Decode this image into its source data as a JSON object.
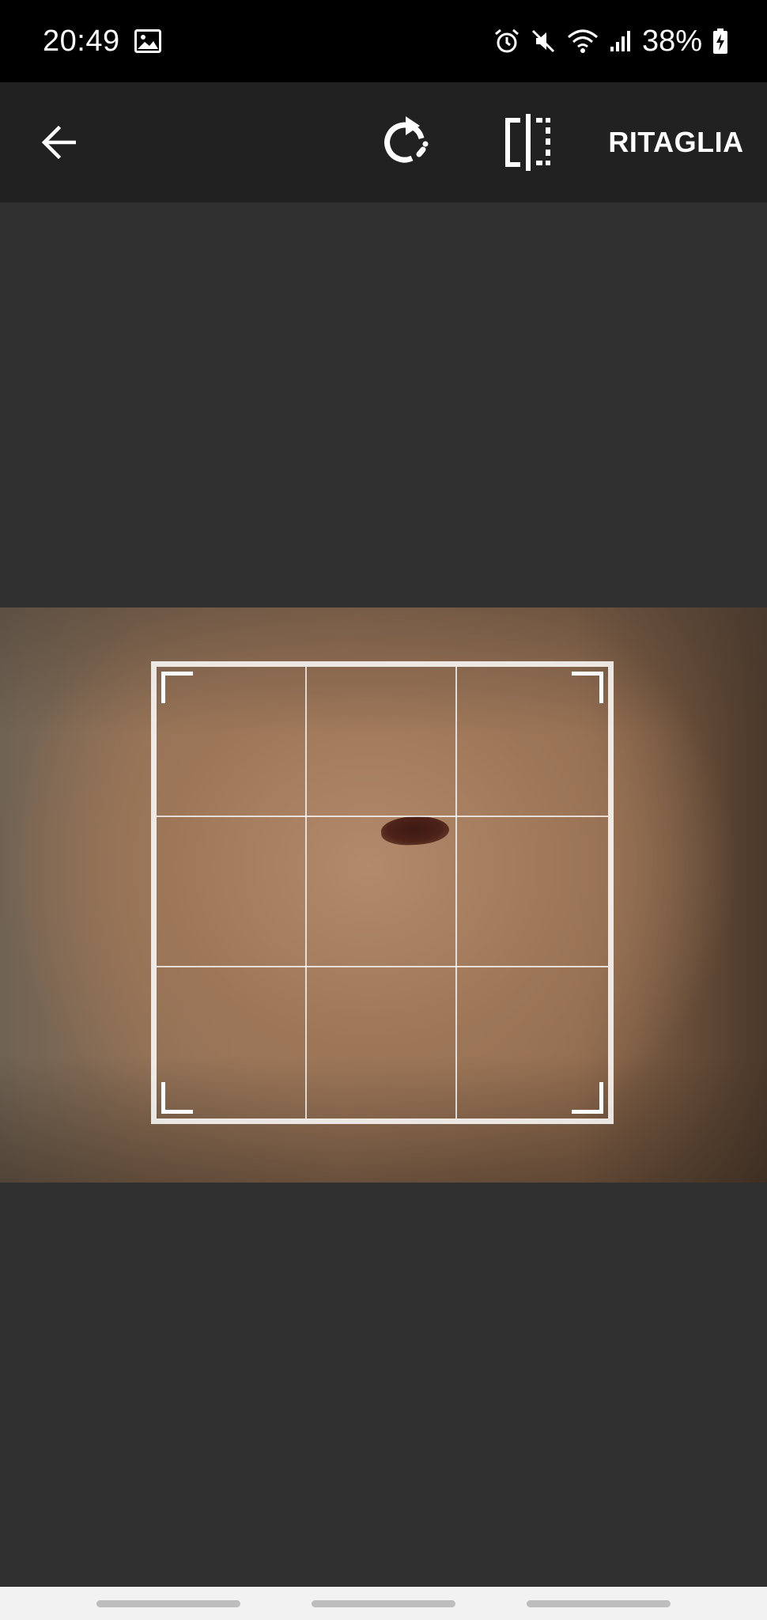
{
  "status_bar": {
    "time": "20:49",
    "battery": "38%",
    "icons": [
      "gallery-icon",
      "alarm-icon",
      "mute-icon",
      "wifi-icon",
      "signal-icon",
      "battery-charging-icon"
    ]
  },
  "toolbar": {
    "back_icon": "arrow-left-icon",
    "rotate_icon": "rotate-icon",
    "flip_icon": "flip-icon",
    "crop_label": "RITAGLIA"
  },
  "colors": {
    "background": "#303030",
    "toolbar": "#212121",
    "status_bar": "#000000",
    "nav_bar": "#f2f2f2"
  }
}
